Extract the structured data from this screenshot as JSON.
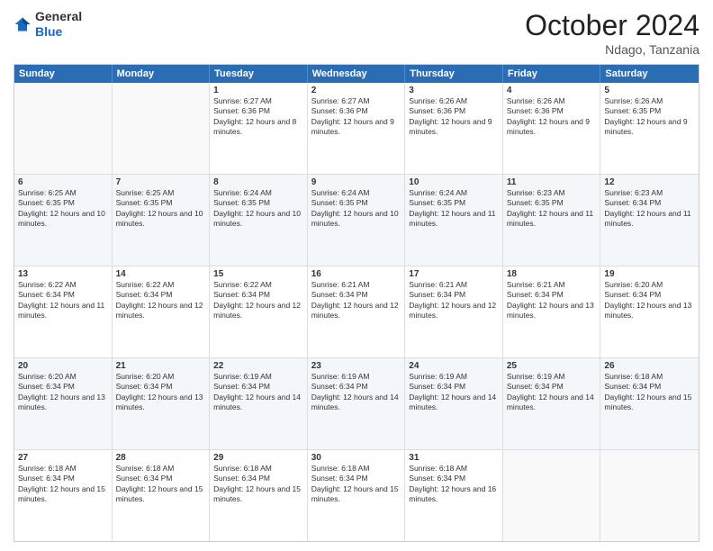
{
  "header": {
    "logo_general": "General",
    "logo_blue": "Blue",
    "month": "October 2024",
    "location": "Ndago, Tanzania"
  },
  "days_of_week": [
    "Sunday",
    "Monday",
    "Tuesday",
    "Wednesday",
    "Thursday",
    "Friday",
    "Saturday"
  ],
  "weeks": [
    [
      {
        "day": "",
        "info": ""
      },
      {
        "day": "",
        "info": ""
      },
      {
        "day": "1",
        "info": "Sunrise: 6:27 AM\nSunset: 6:36 PM\nDaylight: 12 hours and 8 minutes."
      },
      {
        "day": "2",
        "info": "Sunrise: 6:27 AM\nSunset: 6:36 PM\nDaylight: 12 hours and 9 minutes."
      },
      {
        "day": "3",
        "info": "Sunrise: 6:26 AM\nSunset: 6:36 PM\nDaylight: 12 hours and 9 minutes."
      },
      {
        "day": "4",
        "info": "Sunrise: 6:26 AM\nSunset: 6:36 PM\nDaylight: 12 hours and 9 minutes."
      },
      {
        "day": "5",
        "info": "Sunrise: 6:26 AM\nSunset: 6:35 PM\nDaylight: 12 hours and 9 minutes."
      }
    ],
    [
      {
        "day": "6",
        "info": "Sunrise: 6:25 AM\nSunset: 6:35 PM\nDaylight: 12 hours and 10 minutes."
      },
      {
        "day": "7",
        "info": "Sunrise: 6:25 AM\nSunset: 6:35 PM\nDaylight: 12 hours and 10 minutes."
      },
      {
        "day": "8",
        "info": "Sunrise: 6:24 AM\nSunset: 6:35 PM\nDaylight: 12 hours and 10 minutes."
      },
      {
        "day": "9",
        "info": "Sunrise: 6:24 AM\nSunset: 6:35 PM\nDaylight: 12 hours and 10 minutes."
      },
      {
        "day": "10",
        "info": "Sunrise: 6:24 AM\nSunset: 6:35 PM\nDaylight: 12 hours and 11 minutes."
      },
      {
        "day": "11",
        "info": "Sunrise: 6:23 AM\nSunset: 6:35 PM\nDaylight: 12 hours and 11 minutes."
      },
      {
        "day": "12",
        "info": "Sunrise: 6:23 AM\nSunset: 6:34 PM\nDaylight: 12 hours and 11 minutes."
      }
    ],
    [
      {
        "day": "13",
        "info": "Sunrise: 6:22 AM\nSunset: 6:34 PM\nDaylight: 12 hours and 11 minutes."
      },
      {
        "day": "14",
        "info": "Sunrise: 6:22 AM\nSunset: 6:34 PM\nDaylight: 12 hours and 12 minutes."
      },
      {
        "day": "15",
        "info": "Sunrise: 6:22 AM\nSunset: 6:34 PM\nDaylight: 12 hours and 12 minutes."
      },
      {
        "day": "16",
        "info": "Sunrise: 6:21 AM\nSunset: 6:34 PM\nDaylight: 12 hours and 12 minutes."
      },
      {
        "day": "17",
        "info": "Sunrise: 6:21 AM\nSunset: 6:34 PM\nDaylight: 12 hours and 12 minutes."
      },
      {
        "day": "18",
        "info": "Sunrise: 6:21 AM\nSunset: 6:34 PM\nDaylight: 12 hours and 13 minutes."
      },
      {
        "day": "19",
        "info": "Sunrise: 6:20 AM\nSunset: 6:34 PM\nDaylight: 12 hours and 13 minutes."
      }
    ],
    [
      {
        "day": "20",
        "info": "Sunrise: 6:20 AM\nSunset: 6:34 PM\nDaylight: 12 hours and 13 minutes."
      },
      {
        "day": "21",
        "info": "Sunrise: 6:20 AM\nSunset: 6:34 PM\nDaylight: 12 hours and 13 minutes."
      },
      {
        "day": "22",
        "info": "Sunrise: 6:19 AM\nSunset: 6:34 PM\nDaylight: 12 hours and 14 minutes."
      },
      {
        "day": "23",
        "info": "Sunrise: 6:19 AM\nSunset: 6:34 PM\nDaylight: 12 hours and 14 minutes."
      },
      {
        "day": "24",
        "info": "Sunrise: 6:19 AM\nSunset: 6:34 PM\nDaylight: 12 hours and 14 minutes."
      },
      {
        "day": "25",
        "info": "Sunrise: 6:19 AM\nSunset: 6:34 PM\nDaylight: 12 hours and 14 minutes."
      },
      {
        "day": "26",
        "info": "Sunrise: 6:18 AM\nSunset: 6:34 PM\nDaylight: 12 hours and 15 minutes."
      }
    ],
    [
      {
        "day": "27",
        "info": "Sunrise: 6:18 AM\nSunset: 6:34 PM\nDaylight: 12 hours and 15 minutes."
      },
      {
        "day": "28",
        "info": "Sunrise: 6:18 AM\nSunset: 6:34 PM\nDaylight: 12 hours and 15 minutes."
      },
      {
        "day": "29",
        "info": "Sunrise: 6:18 AM\nSunset: 6:34 PM\nDaylight: 12 hours and 15 minutes."
      },
      {
        "day": "30",
        "info": "Sunrise: 6:18 AM\nSunset: 6:34 PM\nDaylight: 12 hours and 15 minutes."
      },
      {
        "day": "31",
        "info": "Sunrise: 6:18 AM\nSunset: 6:34 PM\nDaylight: 12 hours and 16 minutes."
      },
      {
        "day": "",
        "info": ""
      },
      {
        "day": "",
        "info": ""
      }
    ]
  ]
}
